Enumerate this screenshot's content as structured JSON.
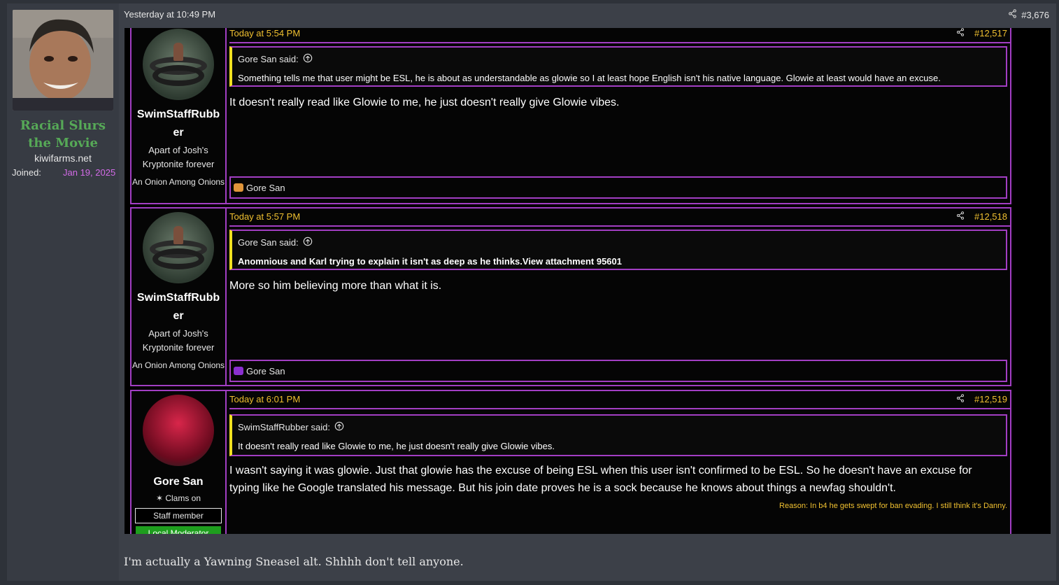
{
  "outer": {
    "user": {
      "name": "Racial Slurs the Movie",
      "site": "kiwifarms.net",
      "joined_label": "Joined:",
      "joined_value": "Jan 19, 2025"
    },
    "timestamp": "Yesterday at 10:49 PM",
    "post_number": "#3,676",
    "body": "I'm actually a Yawning Sneasel alt. Shhhh don't tell anyone."
  },
  "embedded_posts": [
    {
      "user": {
        "name": "SwimStaffRubber",
        "title": "Apart of Josh's Kryptonite forever",
        "rank": "An Onion Among Onions"
      },
      "date": "Today at 5:54 PM",
      "number": "#12,517",
      "quote_author": "Gore San said:",
      "quote_text": "Something tells me that user might be ESL, he is about as understandable as glowie so I at least hope English isn't his native language. Glowie at least would have an excuse.",
      "body": "It doesn't really read like Glowie to me, he just doesn't really give Glowie vibes.",
      "reaction_user": "Gore San"
    },
    {
      "user": {
        "name": "SwimStaffRubber",
        "title": "Apart of Josh's Kryptonite forever",
        "rank": "An Onion Among Onions"
      },
      "date": "Today at 5:57 PM",
      "number": "#12,518",
      "quote_author": "Gore San said:",
      "quote_text": "Anomnious and Karl trying to explain it isn't as deep as he thinks.View attachment 95601",
      "body": "More so him believing more than what it is.",
      "reaction_user": "Gore San"
    },
    {
      "user": {
        "name": "Gore San",
        "title": "✶ Clams on",
        "badge_staff": "Staff member",
        "badge_mod": "Local Moderator"
      },
      "date": "Today at 6:01 PM",
      "number": "#12,519",
      "quote_author": "SwimStaffRubber said:",
      "quote_text": "It doesn't really read like Glowie to me, he just doesn't really give Glowie vibes.",
      "body_line1": "I wasn't saying it was glowie. Just that glowie has the excuse of being ESL when this user isn't confirmed to be ESL. So he doesn't have an excuse for",
      "body_line2": "typing like he Google translated his message. But his join date proves he is a sock because he knows about things a newfag shouldn't.",
      "reason": "Reason: In b4 he gets swept for ban evading. I still think it's Danny."
    }
  ],
  "colors": {
    "accent_border": "#a23ec3",
    "gold": "#f0c030",
    "username_green": "#56a957",
    "joined_purple": "#d36be8",
    "quote_bar": "#f0e020"
  },
  "icons": [
    "share-icon",
    "arrow-up-circle-icon",
    "reaction-icon"
  ]
}
